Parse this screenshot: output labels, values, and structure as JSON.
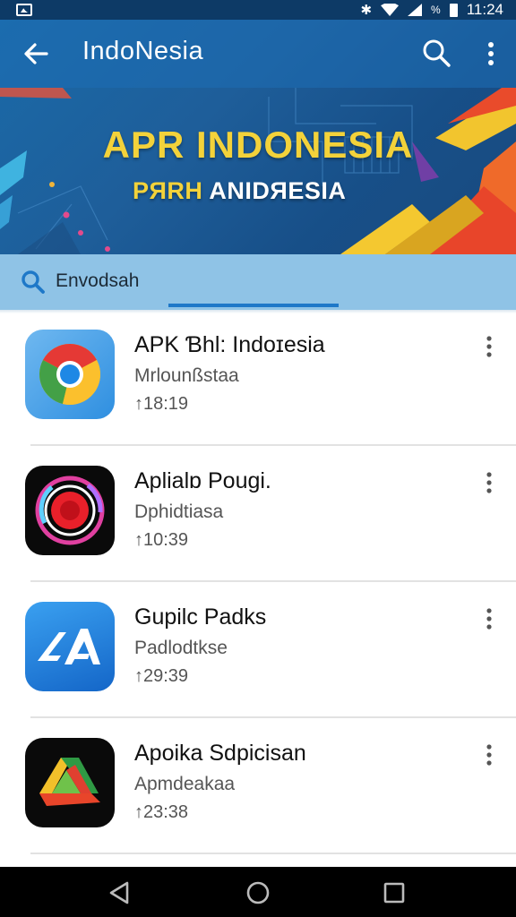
{
  "status_bar": {
    "time": "11:24",
    "battery_pct": "%",
    "icons": [
      "notification-icon",
      "bluetooth-icon",
      "wifi-icon",
      "signal-icon",
      "battery-icon"
    ]
  },
  "header": {
    "title": "IndoNesia",
    "back_icon": "back-arrow-icon",
    "search_icon": "search-icon",
    "more_icon": "more-vert-icon"
  },
  "banner": {
    "title": "APR INDONESIA",
    "subtitle_yellow": "PЯRH",
    "subtitle_white": "ANIDЯESIA"
  },
  "search": {
    "text": "Envodsah",
    "icon": "search-icon"
  },
  "apps": [
    {
      "title": "APK Ɓhl: Indoɪesia",
      "subtitle": "Mrlounßstaa",
      "time": "↑18:19",
      "icon": "chrome-style-icon",
      "more_icon": "more-vert-icon"
    },
    {
      "title": "Aplialɒ Pougi.",
      "subtitle": "Dphidtiasa",
      "time": "↑10:39",
      "icon": "camera-ring-icon",
      "more_icon": "more-vert-icon"
    },
    {
      "title": "Gupilc Padks",
      "subtitle": "Padlodtkse",
      "time": "↑29:39",
      "icon": "app-store-icon",
      "more_icon": "more-vert-icon"
    },
    {
      "title": "Apoika Sdpicisan",
      "subtitle": "Apmdeakaa",
      "time": "↑23:38",
      "icon": "drive-style-icon",
      "more_icon": "more-vert-icon"
    }
  ],
  "nav_bar": {
    "buttons": [
      "back-triangle-icon",
      "home-circle-icon",
      "recents-square-icon"
    ]
  },
  "colors": {
    "status_bar": "#0d3a66",
    "banner_blue": "#1a5f9c",
    "banner_yellow": "#f3d23a",
    "search_bar": "#8fc3e6",
    "tab_indicator": "#1e78c8"
  }
}
